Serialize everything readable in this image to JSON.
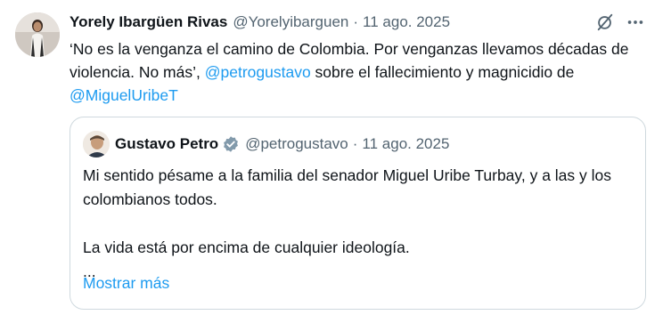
{
  "tweet": {
    "author_name": "Yorely Ibargüen Rivas",
    "author_handle": "@Yorelyibarguen",
    "separator": "·",
    "timestamp": "11 ago. 2025",
    "text_1": "‘No es la venganza el camino de Colombia. Por venganzas llevamos décadas de violencia. No más’, ",
    "mention_1": "@petrogustavo",
    "text_2": " sobre el fallecimiento y magnicidio de ",
    "mention_2": "@MiguelUribeT",
    "icons": {
      "grok": "grok-slash-circle-icon",
      "more": "more-dots-icon"
    }
  },
  "quoted_tweet": {
    "author_name": "Gustavo Petro",
    "author_handle": "@petrogustavo",
    "separator": "·",
    "timestamp": "11 ago. 2025",
    "verified_badge": "verified-badge-icon",
    "lines": [
      "Mi sentido pésame a la familia del senador Miguel Uribe Turbay, y a las y los colombianos todos.",
      "",
      "La vida está por encima de cualquier ideología.",
      "..."
    ],
    "show_more": "Mostrar más"
  },
  "colors": {
    "text": "#0f1419",
    "secondary": "#536471",
    "link": "#1d9bf0",
    "border": "#cfd9de",
    "verified": "#829aab"
  }
}
